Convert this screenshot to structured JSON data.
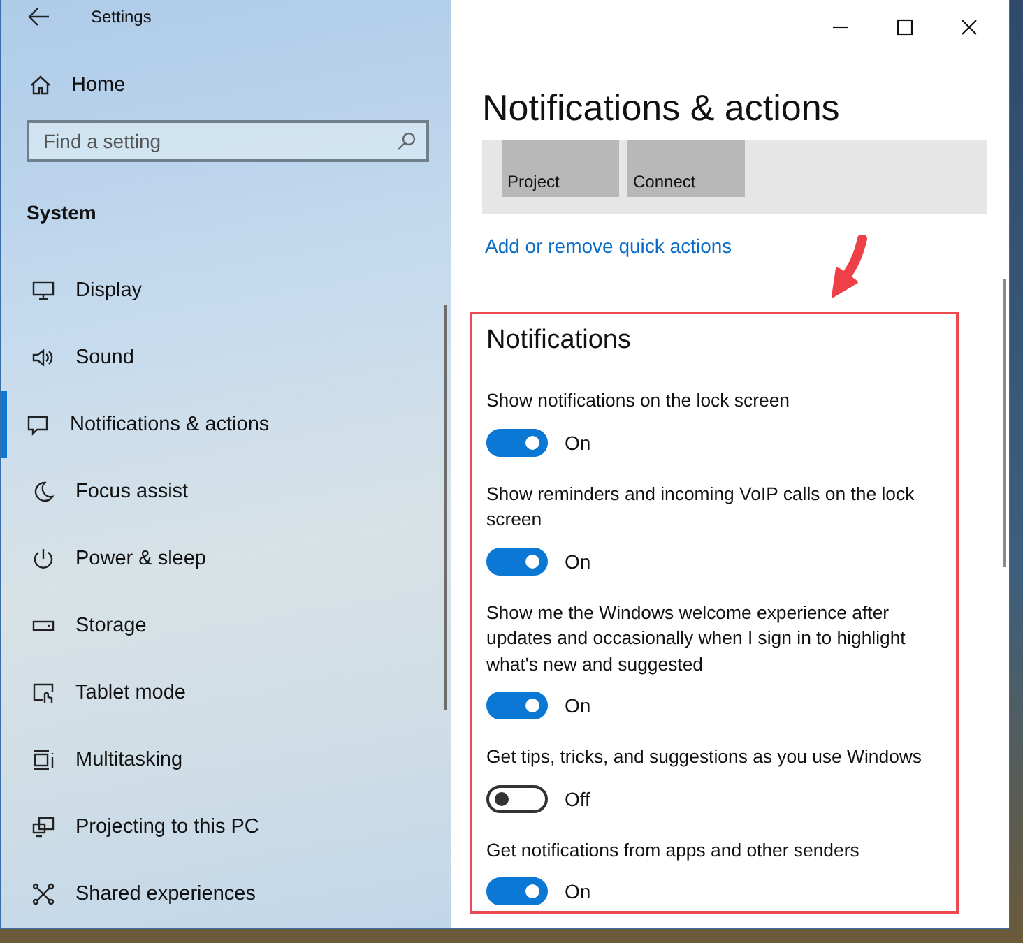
{
  "window": {
    "title": "Settings"
  },
  "sidebar": {
    "home": "Home",
    "search": {
      "placeholder": "Find a setting"
    },
    "section": "System",
    "items": [
      {
        "label": "Display",
        "kind": "display",
        "selected": false
      },
      {
        "label": "Sound",
        "kind": "sound",
        "selected": false
      },
      {
        "label": "Notifications & actions",
        "kind": "notifications",
        "selected": true
      },
      {
        "label": "Focus assist",
        "kind": "moon",
        "selected": false
      },
      {
        "label": "Power & sleep",
        "kind": "power",
        "selected": false
      },
      {
        "label": "Storage",
        "kind": "storage",
        "selected": false
      },
      {
        "label": "Tablet mode",
        "kind": "tablet",
        "selected": false
      },
      {
        "label": "Multitasking",
        "kind": "multitasking",
        "selected": false
      },
      {
        "label": "Projecting to this PC",
        "kind": "projecting",
        "selected": false
      },
      {
        "label": "Shared experiences",
        "kind": "shared",
        "selected": false
      }
    ]
  },
  "page": {
    "title": "Notifications & actions",
    "quick_actions": [
      {
        "label": "Project"
      },
      {
        "label": "Connect"
      }
    ],
    "link": "Add or remove quick actions",
    "notifications": {
      "heading": "Notifications",
      "highlighted": true,
      "settings": [
        {
          "label": "Show notifications on the lock screen",
          "on": true,
          "state_text": "On"
        },
        {
          "label": "Show reminders and incoming VoIP calls on the lock screen",
          "on": true,
          "state_text": "On"
        },
        {
          "label": "Show me the Windows welcome experience after updates and occasionally when I sign in to highlight what's new and suggested",
          "on": true,
          "state_text": "On"
        },
        {
          "label": "Get tips, tricks, and suggestions as you use Windows",
          "on": false,
          "state_text": "Off"
        },
        {
          "label": "Get notifications from apps and other senders",
          "on": true,
          "state_text": "On"
        }
      ]
    }
  }
}
